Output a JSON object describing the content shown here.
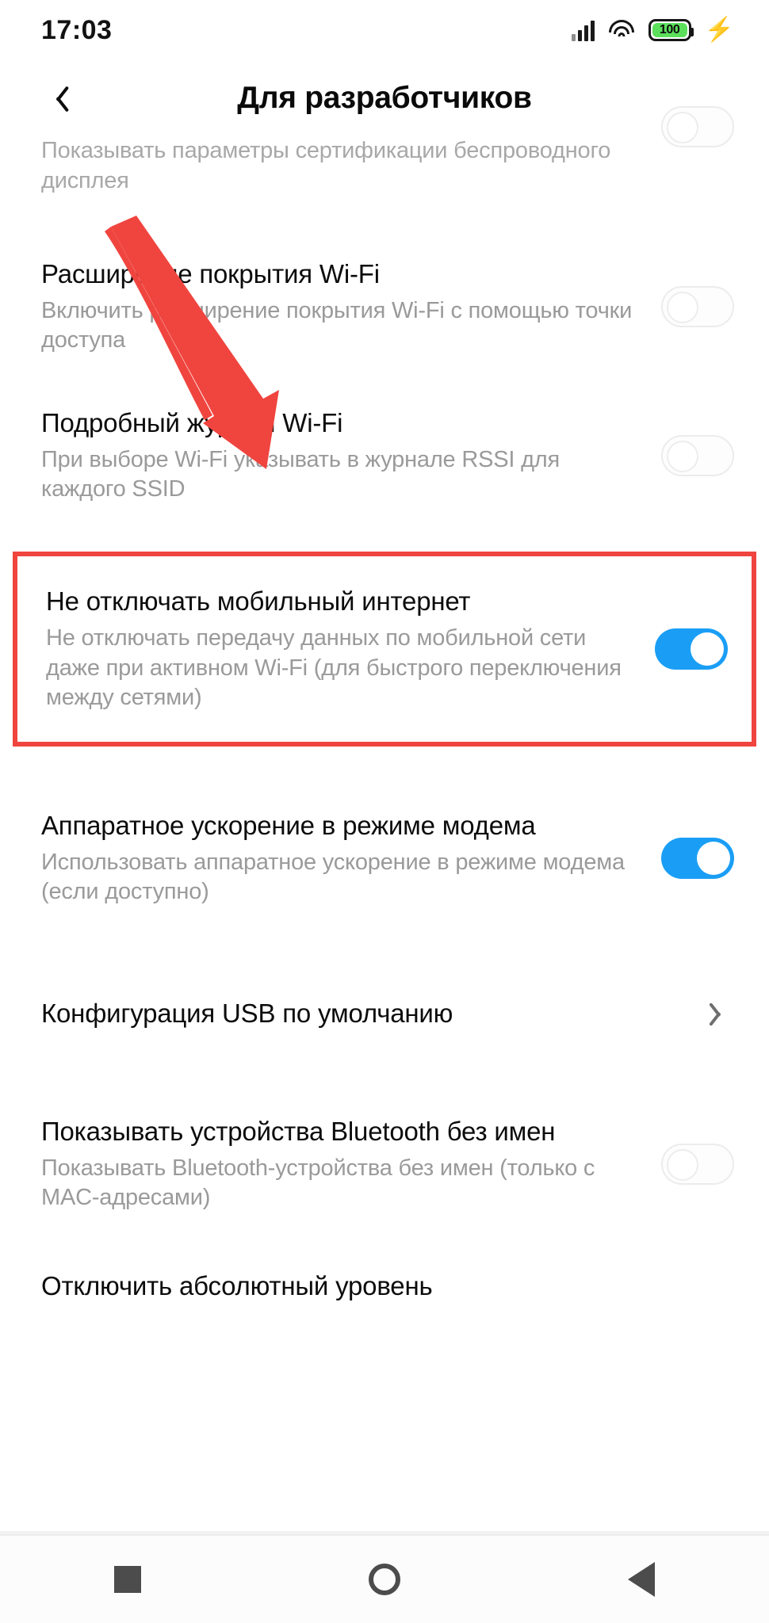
{
  "status_bar": {
    "time": "17:03",
    "battery_level": "100",
    "icons": [
      "signal-icon",
      "wifi-icon",
      "battery-icon",
      "charging-bolt-icon"
    ],
    "battery_color": "#5ce05c"
  },
  "app_bar": {
    "back_label": "‹",
    "title": "Для разработчиков"
  },
  "settings": [
    {
      "title": "",
      "subtitle": "Показывать параметры сертификации беспроводного дисплея",
      "control": "toggle",
      "state": "off",
      "clipped": true
    },
    {
      "title": "Расширение покрытия Wi-Fi",
      "subtitle": "Включить расширение покрытия Wi-Fi с помощью точки доступа",
      "control": "toggle",
      "state": "off",
      "clipped": false
    },
    {
      "title": "Подробный журнал Wi-Fi",
      "subtitle": "При выборе Wi-Fi указывать в журнале RSSI для каждого SSID",
      "control": "toggle",
      "state": "off",
      "clipped": false
    },
    {
      "title": "Не отключать мобильный интернет",
      "subtitle": "Не отключать передачу данных по мобильной сети даже при активном Wi-Fi (для быстрого переключения между сетями)",
      "control": "toggle",
      "state": "on",
      "highlighted": true,
      "clipped": false
    },
    {
      "title": "Аппаратное ускорение в режиме модема",
      "subtitle": "Использовать аппаратное ускорение в режиме модема (если доступно)",
      "control": "toggle",
      "state": "on",
      "clipped": false
    },
    {
      "title": "Конфигурация USB по умолчанию",
      "subtitle": "",
      "control": "chevron",
      "state": "",
      "clipped": false
    },
    {
      "title": "Показывать устройства Bluetooth без имен",
      "subtitle": "Показывать Bluetooth-устройства без имен (только с MAC-адресами)",
      "control": "toggle",
      "state": "off",
      "clipped": false
    },
    {
      "title": "Отключить абсолютный уровень",
      "subtitle": "",
      "control": "none",
      "state": "",
      "clipped": false
    }
  ],
  "annotation": {
    "arrow_color": "#f0453f",
    "highlight_color": "#f0453f"
  },
  "nav_bar": {
    "items": [
      "recents-square-icon",
      "home-circle-icon",
      "back-triangle-icon"
    ],
    "color": "#4c4c4c"
  },
  "colors": {
    "accent_on": "#1a9ef5",
    "title_text": "#0c0c0c",
    "subtitle_text": "#9a9a9a",
    "background": "#ffffff"
  }
}
